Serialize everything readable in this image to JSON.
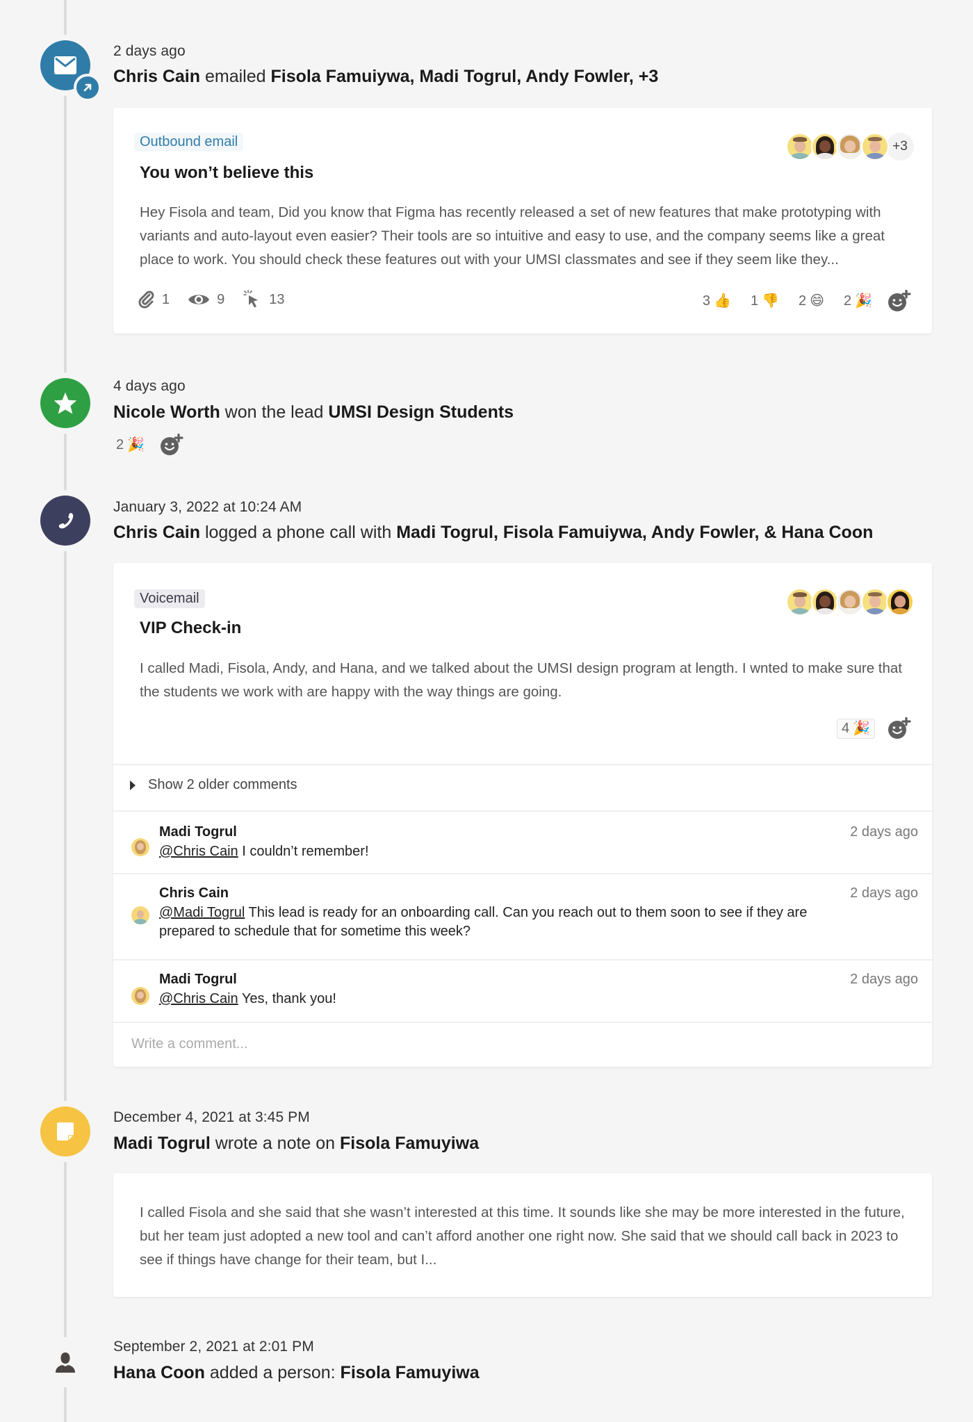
{
  "events": [
    {
      "type": "email",
      "time": "2 days ago",
      "actor": "Chris Cain",
      "verb": " emailed ",
      "target": "Fisola Famuiywa, Madi Togrul, Andy Fowler, +3",
      "tag": "Outbound email",
      "title": "You won’t believe this",
      "body": "Hey Fisola and team, Did you know that Figma has recently released a set of new features that make prototyping with variants and auto-layout even easier? Their tools are so intuitive and easy to use, and the company seems like a great place to work. You should check these features out with your UMSI classmates and see if they seem like they...",
      "more_participants": "+3",
      "stats": {
        "attachments": "1",
        "views": "9",
        "clicks": "13"
      },
      "reactions": [
        {
          "count": "3",
          "emoji": "👍",
          "name": "thumbs-up"
        },
        {
          "count": "1",
          "emoji": "👎",
          "name": "thumbs-down"
        },
        {
          "count": "2",
          "emoji": "😄",
          "name": "grinning"
        },
        {
          "count": "2",
          "emoji": "🎉",
          "name": "party-popper"
        }
      ],
      "icon": "envelope-icon",
      "color": "#2f7ca8"
    },
    {
      "type": "won",
      "time": "4 days ago",
      "actor": "Nicole Worth",
      "verb": " won the lead ",
      "target": "UMSI Design Students",
      "reactions": [
        {
          "count": "2",
          "emoji": "🎉",
          "name": "party-popper"
        }
      ],
      "icon": "star-icon",
      "color": "#2ea043"
    },
    {
      "type": "call",
      "time": "January 3, 2022 at 10:24 AM",
      "actor": "Chris Cain",
      "verb": " logged a phone call with ",
      "target": "Madi Togrul, Fisola Famuiywa, Andy Fowler, & Hana Coon",
      "tag": "Voicemail",
      "title": "VIP Check-in",
      "body": "I called Madi, Fisola, Andy, and Hana, and we talked about the UMSI design program at length. I wnted to make sure that the students we work with are happy with the way things are going.",
      "reactions": [
        {
          "count": "4",
          "emoji": "🎉",
          "name": "party-popper"
        }
      ],
      "older_comments": "Show 2 older comments",
      "comments": [
        {
          "author": "Madi Togrul",
          "mention": "@Chris Cain",
          "text": " I couldn’t remember!",
          "time": "2 days ago"
        },
        {
          "author": "Chris Cain",
          "mention": "@Madi Togrul",
          "text": " This lead is ready for an onboarding  call. Can you reach out to them soon to see if they are prepared to schedule that for sometime this week?",
          "time": "2 days ago"
        },
        {
          "author": "Madi Togrul",
          "mention": "@Chris Cain",
          "text": " Yes, thank you!",
          "time": "2 days ago"
        }
      ],
      "comment_placeholder": "Write a comment...",
      "icon": "phone-icon",
      "color": "#3d3f5e"
    },
    {
      "type": "note",
      "time": "December 4, 2021 at 3:45 PM",
      "actor": "Madi Togrul",
      "verb": " wrote a note on ",
      "target": "Fisola Famuyiwa",
      "body": "I called Fisola and she said that she wasn’t interested at this time. It sounds like she may be more interested in the future, but her team just adopted a new tool and can’t afford another one right now. She said that we should call back in 2023 to see if things have change for their team, but I...",
      "icon": "note-icon",
      "color": "#f6c343"
    },
    {
      "type": "person",
      "time": "September 2, 2021 at 2:01 PM",
      "actor": "Hana Coon",
      "verb": " added a person: ",
      "target": "Fisola Famuyiwa",
      "icon": "person-icon",
      "color": "#4a4443"
    }
  ]
}
